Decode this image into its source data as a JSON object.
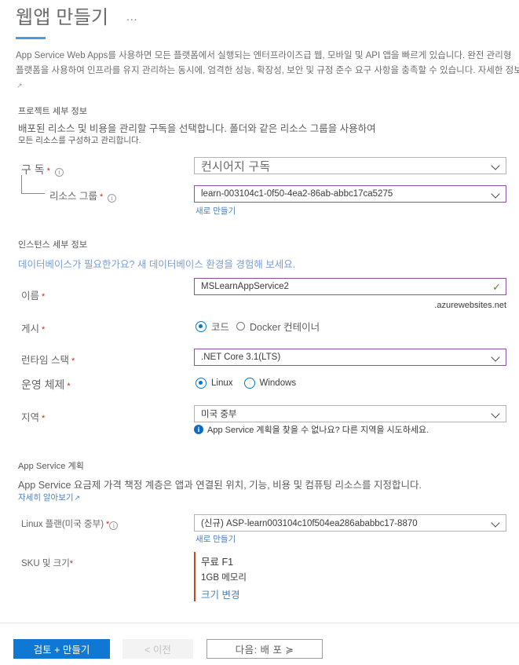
{
  "header": {
    "title": "웹앱 만들기",
    "more_label": "…",
    "description": "App Service Web Apps를 사용하면 모든 플랫폼에서 실행되는 엔터프라이즈급 웹, 모바일 및 API 앱을 빠르게 있습니다. 완전 관리형 플랫폼을 사용하여 인프라를 유지 관리하는 동시에, 엄격한 성능, 확장성, 보안 및 규정 준수 요구 사항을 충족할 수 있습니다. 자세한 정보",
    "description_link_glyph": "↗"
  },
  "project_details": {
    "heading": "프로젝트 세부 정보",
    "description_line1": "배포된 리소스 및 비용을 관리할 구독을 선택합니다. 폴더와 같은 리소스 그룹을 사용하여",
    "description_line2": "모든 리소스를 구성하고 관리합니다.",
    "subscription": {
      "label": "구 독",
      "required": "*",
      "info_glyph": "i",
      "value": "컨시어지 구독"
    },
    "resource_group": {
      "label": "리소스 그룹",
      "required": "*",
      "info_glyph": "i",
      "value": "learn-003104c1-0f50-4ea2-86ab-abbc17ca5275",
      "create_new": "새로 만들기"
    }
  },
  "instance_details": {
    "heading": "인스턴스 세부 정보",
    "database_promo": "데이터베이스가 필요한가요? 새 데이터베이스 환경을 경험해 보세요.",
    "name": {
      "label": "이름",
      "required": "*",
      "value": "MSLearnAppService2",
      "valid_glyph": "✓",
      "domain_suffix": ".azurewebsites.net"
    },
    "publish": {
      "label": "게시",
      "required": "*",
      "options": [
        {
          "label": "코드",
          "selected": true
        },
        {
          "label": "Docker 컨테이너",
          "selected": false
        }
      ]
    },
    "runtime_stack": {
      "label": "런타임 스택",
      "required": "*",
      "value": ".NET Core 3.1(LTS)"
    },
    "operating_system": {
      "label": "운영 체제",
      "required": "*",
      "options": [
        {
          "label": "Linux",
          "selected": true
        },
        {
          "label": "Windows",
          "selected": false
        }
      ]
    },
    "region": {
      "label": "지역",
      "required": "*",
      "value": "미국 중부",
      "hint_icon": "i",
      "hint": "App Service 계획을 찾을 수 없나요? 다른 지역을 시도하세요."
    }
  },
  "app_service_plan": {
    "heading": "App Service 계획",
    "description": "App Service 요금제 가격 책정 계층은 앱과 연결된 위치, 기능, 비용 및 컴퓨팅 리소스를 지정합니다.",
    "learn_more": "자세히 알아보기",
    "learn_more_glyph": "↗",
    "plan": {
      "label": "Linux 플랜(미국 중부)",
      "required": "*",
      "info_glyph": "i",
      "value": "(신규) ASP-learn003104c10f504ea286ababbc17-8870",
      "create_new": "새로 만들기"
    },
    "sku": {
      "label": "SKU 및 크기",
      "required": "*",
      "tier": "무료 F1",
      "memory": "1GB 메모리",
      "change_link": "크기 변경"
    }
  },
  "footer": {
    "review_create": "검토 + 만들기",
    "previous": "< 이전",
    "next": "다음: 배 포   ≽"
  },
  "colors": {
    "primary_blue": "#0f78d4",
    "tab_underline": "#4a9be0",
    "focus_purple": "#8f4f9e",
    "required_red": "#b5302a",
    "sku_accent": "#c4471f",
    "link_blue": "#4a7ebb",
    "valid_green": "#4b8b2b"
  }
}
